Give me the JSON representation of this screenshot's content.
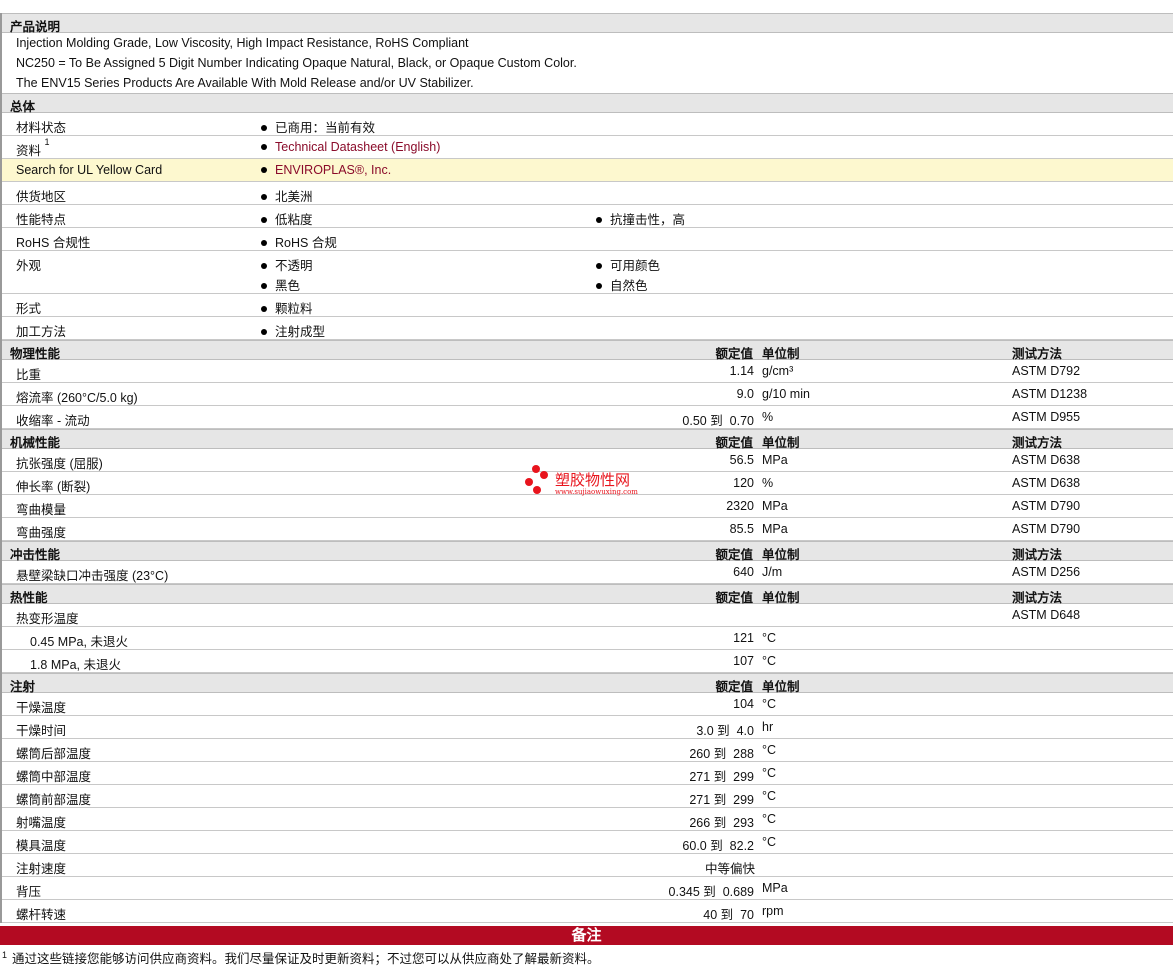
{
  "sections": [
    {
      "title": "产品说明",
      "kind": "desc",
      "lines": [
        "Injection Molding Grade, Low Viscosity, High Impact Resistance, RoHS Compliant",
        "NC250 = To Be Assigned 5 Digit Number Indicating Opaque Natural, Black, or Opaque Custom Color.",
        "The ENV15 Series Products Are Available With Mold Release and/or UV Stabilizer."
      ]
    },
    {
      "title": "总体",
      "kind": "general",
      "rows": [
        {
          "label": "材料状态",
          "col1": [
            "已商用：当前有效"
          ],
          "col2": []
        },
        {
          "label": "资料",
          "sup": "1",
          "col1": [
            "Technical Datasheet (English)"
          ],
          "col2": [],
          "link": true
        },
        {
          "label": "Search for UL Yellow Card",
          "col1": [
            "ENVIROPLAS®, Inc."
          ],
          "col2": [],
          "link": true,
          "highlight": true
        },
        {
          "label": "供货地区",
          "col1": [
            "北美洲"
          ],
          "col2": []
        },
        {
          "label": "性能特点",
          "col1": [
            "低粘度"
          ],
          "col2": [
            "抗撞击性，高"
          ]
        },
        {
          "label": "RoHS 合规性",
          "col1": [
            "RoHS 合规"
          ],
          "col2": []
        },
        {
          "label": "外观",
          "col1": [
            "不透明",
            "黑色"
          ],
          "col2": [
            "可用颜色",
            "自然色"
          ]
        },
        {
          "label": "形式",
          "col1": [
            "颗粒料"
          ],
          "col2": []
        },
        {
          "label": "加工方法",
          "col1": [
            "注射成型"
          ],
          "col2": []
        }
      ]
    },
    {
      "title": "物理性能",
      "kind": "props",
      "headers": {
        "value": "额定值",
        "unit": "单位制",
        "method": "测试方法"
      },
      "rows": [
        {
          "label": "比重",
          "value": "1.14",
          "unit": "g/cm³",
          "method": "ASTM D792"
        },
        {
          "label": "熔流率 (260°C/5.0 kg)",
          "value": "9.0",
          "unit": "g/10 min",
          "method": "ASTM D1238"
        },
        {
          "label": "收缩率 - 流动",
          "value": "0.50 到  0.70",
          "unit": "%",
          "method": "ASTM D955"
        }
      ]
    },
    {
      "title": "机械性能",
      "kind": "props",
      "headers": {
        "value": "额定值",
        "unit": "单位制",
        "method": "测试方法"
      },
      "rows": [
        {
          "label": "抗张强度 (屈服)",
          "value": "56.5",
          "unit": "MPa",
          "method": "ASTM D638"
        },
        {
          "label": "伸长率 (断裂)",
          "value": "120",
          "unit": "%",
          "method": "ASTM D638"
        },
        {
          "label": "弯曲模量",
          "value": "2320",
          "unit": "MPa",
          "method": "ASTM D790"
        },
        {
          "label": "弯曲强度",
          "value": "85.5",
          "unit": "MPa",
          "method": "ASTM D790"
        }
      ]
    },
    {
      "title": "冲击性能",
      "kind": "props",
      "headers": {
        "value": "额定值",
        "unit": "单位制",
        "method": "测试方法"
      },
      "rows": [
        {
          "label": "悬壁梁缺口冲击强度 (23°C)",
          "value": "640",
          "unit": "J/m",
          "method": "ASTM D256"
        }
      ]
    },
    {
      "title": "热性能",
      "kind": "props",
      "headers": {
        "value": "额定值",
        "unit": "单位制",
        "method": "测试方法"
      },
      "rows": [
        {
          "label": "热变形温度",
          "value": "",
          "unit": "",
          "method": "ASTM D648"
        },
        {
          "label": "0.45 MPa, 未退火",
          "value": "121",
          "unit": "°C",
          "method": "",
          "indent": true
        },
        {
          "label": "1.8 MPa, 未退火",
          "value": "107",
          "unit": "°C",
          "method": "",
          "indent": true
        }
      ]
    },
    {
      "title": "注射",
      "kind": "props",
      "headers": {
        "value": "额定值",
        "unit": "单位制"
      },
      "rows": [
        {
          "label": "干燥温度",
          "value": "104",
          "unit": "°C"
        },
        {
          "label": "干燥时间",
          "value": "3.0 到  4.0",
          "unit": "hr"
        },
        {
          "label": "螺筒后部温度",
          "value": "260 到  288",
          "unit": "°C"
        },
        {
          "label": "螺筒中部温度",
          "value": "271 到  299",
          "unit": "°C"
        },
        {
          "label": "螺筒前部温度",
          "value": "271 到  299",
          "unit": "°C"
        },
        {
          "label": "射嘴温度",
          "value": "266 到  293",
          "unit": "°C"
        },
        {
          "label": "模具温度",
          "value": "60.0 到  82.2",
          "unit": "°C"
        },
        {
          "label": "注射速度",
          "text": "中等偏快"
        },
        {
          "label": "背压",
          "value": "0.345 到  0.689",
          "unit": "MPa"
        },
        {
          "label": "螺杆转速",
          "value": "40 到  70",
          "unit": "rpm"
        }
      ]
    }
  ],
  "notes": {
    "title": "备注",
    "footnote_mark": "1",
    "footnote": "通过这些链接您能够访问供应商资料。我们尽量保证及时更新资料；不过您可以从供应商处了解最新资料。"
  },
  "watermark": {
    "name": "塑胶物性网",
    "url": "www.sujiaowuxing.com"
  },
  "colors": {
    "link": "#8a0b2a",
    "notes_bar": "#b30a22",
    "highlight": "#fdf8cf",
    "section_bg": "#e6e6e6"
  }
}
